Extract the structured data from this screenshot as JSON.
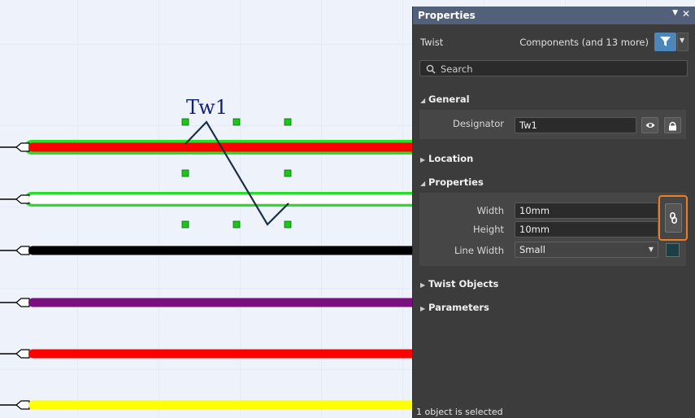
{
  "canvas": {
    "designator": "Tw1",
    "wire_colors": [
      "#ff0000",
      "#ffffff",
      "#000000",
      "#7a1080",
      "#ff0000",
      "#ffff00"
    ],
    "selected_glow": "#25e125",
    "handle_color": "#19c719"
  },
  "panel": {
    "title": "Properties",
    "object_kind": "Twist",
    "filter_label": "Components (and 13 more)",
    "search_placeholder": "Search",
    "accent": "#4d86b8",
    "highlight": "#ee7d22",
    "sections": {
      "general": "General",
      "location": "Location",
      "properties": "Properties",
      "twist_objects": "Twist Objects",
      "parameters": "Parameters"
    },
    "general": {
      "designator_label": "Designator",
      "designator_value": "Tw1"
    },
    "props": {
      "width_label": "Width",
      "width_value": "10mm",
      "height_label": "Height",
      "height_value": "10mm",
      "line_width_label": "Line Width",
      "line_width_value": "Small"
    },
    "status": "1 object is selected"
  }
}
